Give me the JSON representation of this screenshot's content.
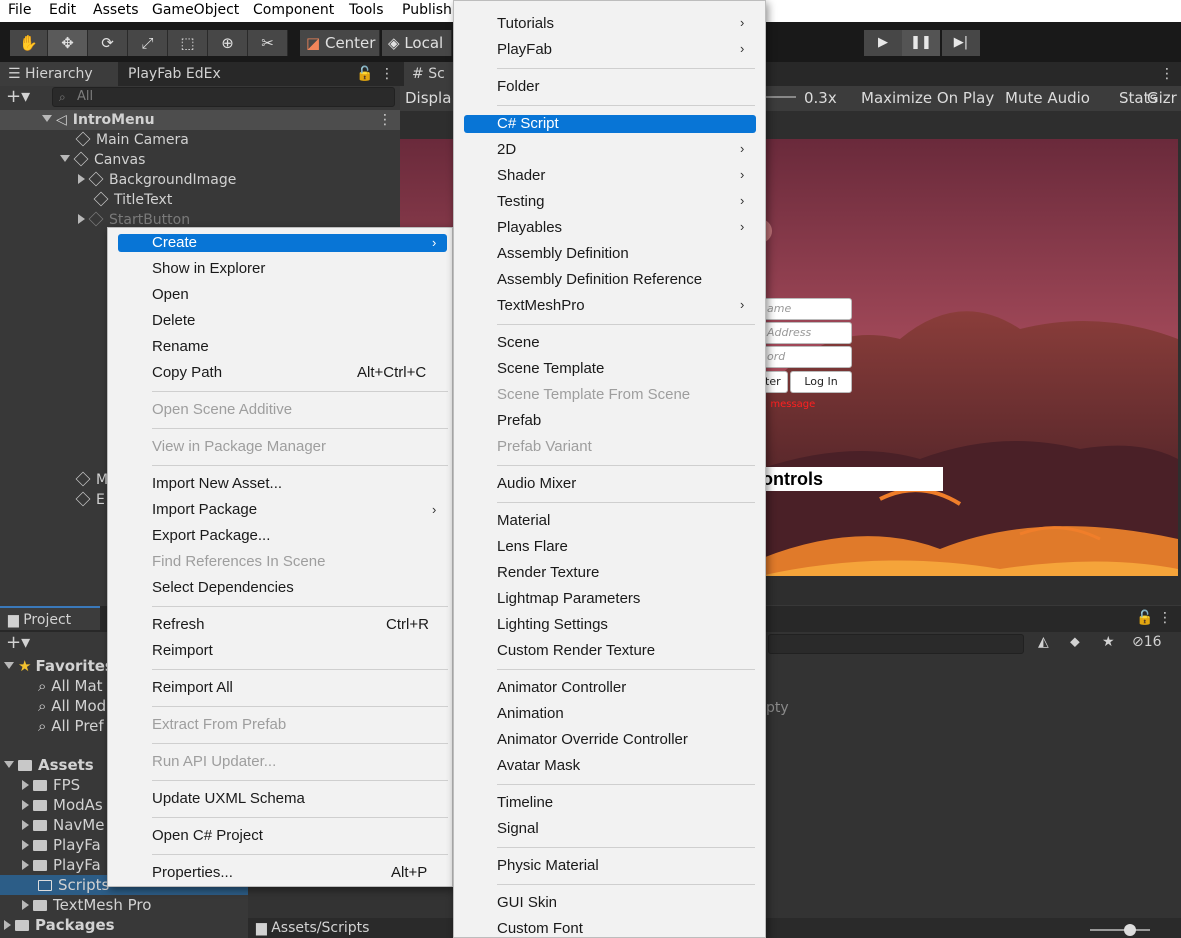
{
  "menubar": [
    "File",
    "Edit",
    "Assets",
    "GameObject",
    "Component",
    "Tools",
    "Publish"
  ],
  "toolbar": {
    "center_label": "Center",
    "local_label": "Local"
  },
  "hierarchy": {
    "tab_label": "Hierarchy",
    "tab2_label": "PlayFab EdEx",
    "search_placeholder": "All",
    "scene_name": "IntroMenu",
    "items": [
      "Main Camera",
      "Canvas",
      "BackgroundImage",
      "TitleText",
      "StartButton"
    ],
    "partial_items": [
      "M",
      "E"
    ]
  },
  "scene": {
    "tab_label": "Sc",
    "display_label": "Displa",
    "scale_value": "0.3x",
    "maximize_label": "Maximize On Play",
    "mute_label": "Mute Audio",
    "stats_label": "Stats",
    "gizmos_label": "Gizr"
  },
  "game": {
    "name_placeholder": "ame",
    "email_placeholder": "Address",
    "password_placeholder": "ord",
    "register_label": "ter",
    "login_label": "Log In",
    "error_text": ". message",
    "controls_text": "ontrols"
  },
  "project": {
    "tab_label": "Project",
    "favorites_label": "Favorites",
    "favorites": [
      "All Mat",
      "All Mod",
      "All Pref"
    ],
    "assets_label": "Assets",
    "folders": [
      "FPS",
      "ModAs",
      "NavMe",
      "PlayFa",
      "PlayFa",
      "Scripts",
      "TextMesh Pro"
    ],
    "packages_label": "Packages",
    "path": "Assets/Scripts",
    "empty_text": "pty",
    "hidden_count": "16"
  },
  "context_menu": {
    "items": [
      {
        "label": "Create",
        "arrow": true,
        "highlighted": true
      },
      {
        "label": "Show in Explorer"
      },
      {
        "label": "Open"
      },
      {
        "label": "Delete"
      },
      {
        "label": "Rename"
      },
      {
        "label": "Copy Path",
        "shortcut": "Alt+Ctrl+C"
      },
      {
        "label": "Open Scene Additive",
        "disabled": true
      },
      {
        "label": "View in Package Manager",
        "disabled": true
      },
      {
        "label": "Import New Asset..."
      },
      {
        "label": "Import Package",
        "arrow": true
      },
      {
        "label": "Export Package..."
      },
      {
        "label": "Find References In Scene",
        "disabled": true
      },
      {
        "label": "Select Dependencies"
      },
      {
        "label": "Refresh",
        "shortcut": "Ctrl+R"
      },
      {
        "label": "Reimport"
      },
      {
        "label": "Reimport All"
      },
      {
        "label": "Extract From Prefab",
        "disabled": true
      },
      {
        "label": "Run API Updater...",
        "disabled": true
      },
      {
        "label": "Update UXML Schema"
      },
      {
        "label": "Open C# Project"
      },
      {
        "label": "Properties...",
        "shortcut": "Alt+P"
      }
    ]
  },
  "create_submenu": {
    "items": [
      {
        "label": "Tutorials",
        "arrow": true
      },
      {
        "label": "PlayFab",
        "arrow": true
      },
      {
        "label": "Folder"
      },
      {
        "label": "C# Script",
        "highlighted": true
      },
      {
        "label": "2D",
        "arrow": true
      },
      {
        "label": "Shader",
        "arrow": true
      },
      {
        "label": "Testing",
        "arrow": true
      },
      {
        "label": "Playables",
        "arrow": true
      },
      {
        "label": "Assembly Definition"
      },
      {
        "label": "Assembly Definition Reference"
      },
      {
        "label": "TextMeshPro",
        "arrow": true
      },
      {
        "label": "Scene"
      },
      {
        "label": "Scene Template"
      },
      {
        "label": "Scene Template From Scene",
        "disabled": true
      },
      {
        "label": "Prefab"
      },
      {
        "label": "Prefab Variant",
        "disabled": true
      },
      {
        "label": "Audio Mixer"
      },
      {
        "label": "Material"
      },
      {
        "label": "Lens Flare"
      },
      {
        "label": "Render Texture"
      },
      {
        "label": "Lightmap Parameters"
      },
      {
        "label": "Lighting Settings"
      },
      {
        "label": "Custom Render Texture"
      },
      {
        "label": "Animator Controller"
      },
      {
        "label": "Animation"
      },
      {
        "label": "Animator Override Controller"
      },
      {
        "label": "Avatar Mask"
      },
      {
        "label": "Timeline"
      },
      {
        "label": "Signal"
      },
      {
        "label": "Physic Material"
      },
      {
        "label": "GUI Skin"
      },
      {
        "label": "Custom Font"
      }
    ]
  }
}
